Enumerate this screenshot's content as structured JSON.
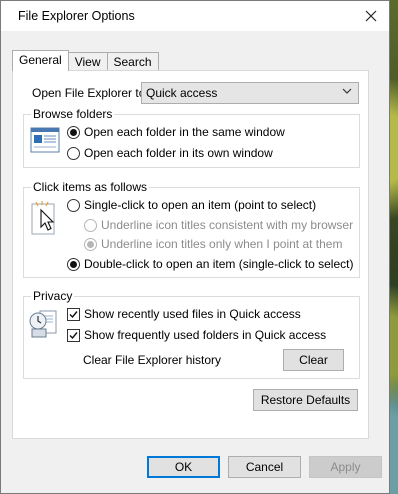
{
  "window": {
    "title": "File Explorer Options",
    "close_icon": "close-icon"
  },
  "tabs": [
    {
      "label": "General",
      "active": true
    },
    {
      "label": "View",
      "active": false
    },
    {
      "label": "Search",
      "active": false
    }
  ],
  "open_to": {
    "label": "Open File Explorer to:",
    "value": "Quick access"
  },
  "browse_folders": {
    "label": "Browse folders",
    "options": [
      {
        "label": "Open each folder in the same window",
        "checked": true
      },
      {
        "label": "Open each folder in its own window",
        "checked": false
      }
    ]
  },
  "click_items": {
    "label": "Click items as follows",
    "options": [
      {
        "label": "Single-click to open an item (point to select)",
        "checked": false
      },
      {
        "label": "Underline icon titles consistent with my browser",
        "checked": false,
        "disabled": true
      },
      {
        "label": "Underline icon titles only when I point at them",
        "checked": true,
        "disabled": true
      },
      {
        "label": "Double-click to open an item (single-click to select)",
        "checked": true
      }
    ]
  },
  "privacy": {
    "label": "Privacy",
    "checks": [
      {
        "label": "Show recently used files in Quick access",
        "checked": true
      },
      {
        "label": "Show frequently used folders in Quick access",
        "checked": true
      }
    ],
    "clear_history_label": "Clear File Explorer history",
    "clear_button": "Clear"
  },
  "restore_defaults": "Restore Defaults",
  "footer": {
    "ok": "OK",
    "cancel": "Cancel",
    "apply": "Apply"
  },
  "colors": {
    "accent": "#0078d7",
    "panel": "#ffffff",
    "dialog": "#f0f0f0"
  }
}
